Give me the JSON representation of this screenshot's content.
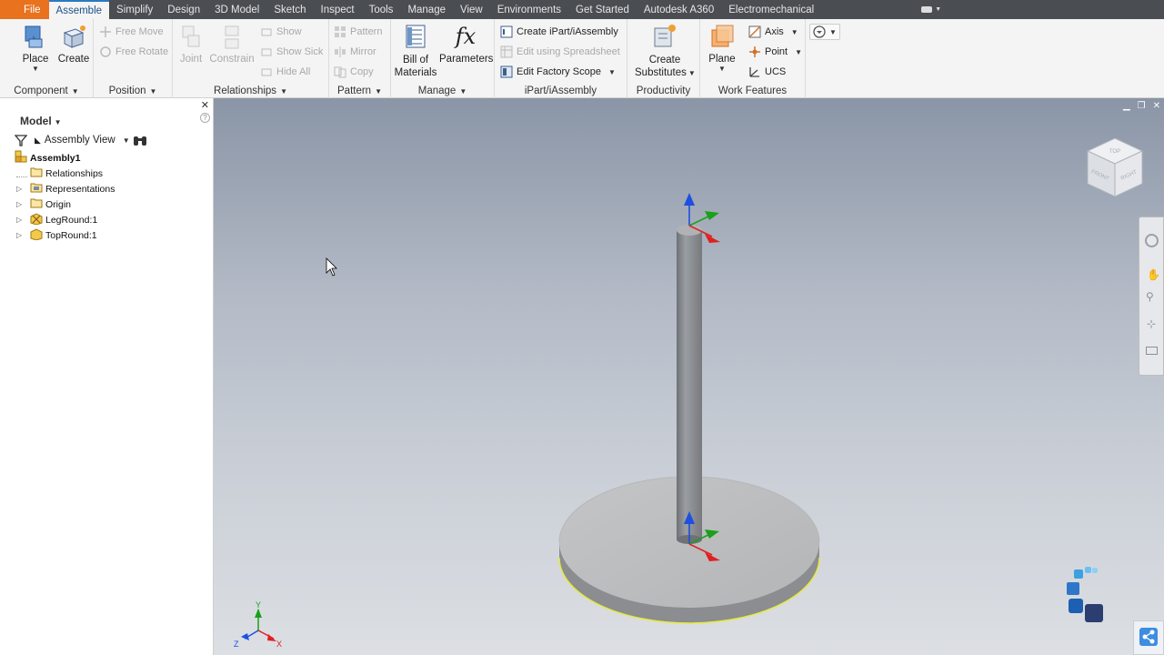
{
  "tabs": [
    "File",
    "Assemble",
    "Simplify",
    "Design",
    "3D Model",
    "Sketch",
    "Inspect",
    "Tools",
    "Manage",
    "View",
    "Environments",
    "Get Started",
    "Autodesk A360",
    "Electromechanical"
  ],
  "active_tab": "Assemble",
  "ribbon": {
    "component": {
      "title": "Component",
      "place": "Place",
      "create": "Create"
    },
    "position": {
      "title": "Position",
      "free_move": "Free Move",
      "free_rotate": "Free Rotate"
    },
    "relationships": {
      "title": "Relationships",
      "joint": "Joint",
      "constrain": "Constrain",
      "show": "Show",
      "show_sick": "Show Sick",
      "hide_all": "Hide All"
    },
    "pattern": {
      "title": "Pattern",
      "pattern": "Pattern",
      "mirror": "Mirror",
      "copy": "Copy"
    },
    "manage": {
      "title": "Manage",
      "bom_line1": "Bill of",
      "bom_line2": "Materials",
      "parameters": "Parameters",
      "fx": "fx"
    },
    "ipart": {
      "title": "iPart/iAssembly",
      "create": "Create iPart/iAssembly",
      "edit_spreadsheet": "Edit using Spreadsheet",
      "edit_factory": "Edit Factory Scope"
    },
    "productivity": {
      "title": "Productivity",
      "line1": "Create",
      "line2": "Substitutes"
    },
    "work_features": {
      "title": "Work Features",
      "plane": "Plane",
      "axis": "Axis",
      "point": "Point",
      "ucs": "UCS"
    }
  },
  "browser": {
    "title": "Model",
    "view": "Assembly View",
    "items": [
      {
        "label": "Assembly1",
        "bold": true
      },
      {
        "label": "Relationships"
      },
      {
        "label": "Representations"
      },
      {
        "label": "Origin"
      },
      {
        "label": "LegRound:1"
      },
      {
        "label": "TopRound:1"
      }
    ]
  },
  "viewcube": {
    "front": "FRONT",
    "right": "RIGHT",
    "top": "TOP"
  },
  "axis_labels": {
    "x": "X",
    "y": "Y",
    "z": "Z"
  },
  "colors": {
    "file_tab": "#e8721e",
    "accent": "#2b79c2",
    "x_axis": "#e02020",
    "y_axis": "#1aa01a",
    "z_axis": "#1d4fe0",
    "edge_highlight": "#e6ea3a"
  }
}
